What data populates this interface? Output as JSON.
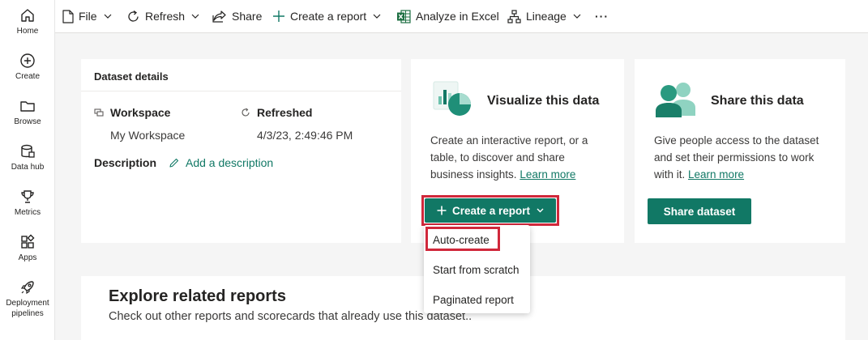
{
  "nav": {
    "items": [
      {
        "label": "Home",
        "icon": "home-icon"
      },
      {
        "label": "Create",
        "icon": "plus-circle-icon"
      },
      {
        "label": "Browse",
        "icon": "folder-icon"
      },
      {
        "label": "Data hub",
        "icon": "database-icon"
      },
      {
        "label": "Metrics",
        "icon": "trophy-icon"
      },
      {
        "label": "Apps",
        "icon": "apps-icon"
      },
      {
        "label": "Deployment pipelines",
        "icon": "rocket-icon"
      }
    ]
  },
  "toolbar": {
    "file": "File",
    "refresh": "Refresh",
    "share": "Share",
    "create_report": "Create a report",
    "analyze": "Analyze in Excel",
    "lineage": "Lineage",
    "more": "···"
  },
  "details": {
    "title": "Dataset details",
    "workspace_label": "Workspace",
    "workspace_value": "My Workspace",
    "refreshed_label": "Refreshed",
    "refreshed_value": "4/3/23, 2:49:46 PM",
    "description_label": "Description",
    "add_description": "Add a description"
  },
  "visualize": {
    "title": "Visualize this data",
    "body": "Create an interactive report, or a table, to discover and share business insights.",
    "learn_more": "Learn more",
    "button": "Create a report"
  },
  "share_card": {
    "title": "Share this data",
    "body": "Give people access to the dataset and set their permissions to work with it.",
    "learn_more": "Learn more",
    "button": "Share dataset"
  },
  "menu": {
    "items": [
      "Auto-create",
      "Start from scratch",
      "Paginated report"
    ]
  },
  "explore": {
    "title": "Explore related reports",
    "subtitle": "Check out other reports and scorecards that already use this dataset.."
  },
  "colors": {
    "accent": "#117865",
    "highlight": "#d0283b"
  }
}
